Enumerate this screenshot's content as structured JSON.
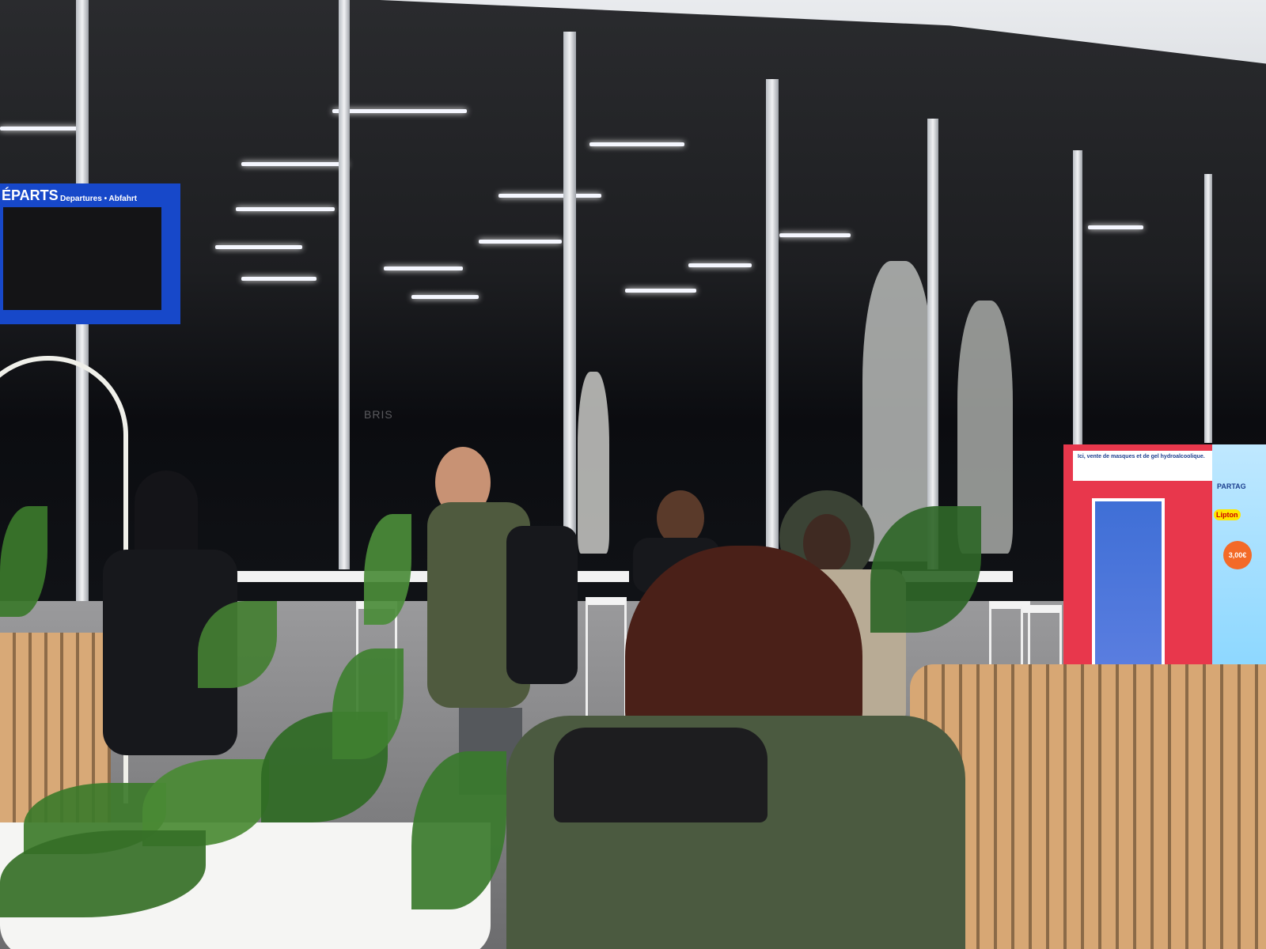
{
  "scene": {
    "description_type": "photo",
    "departures_sign": {
      "title": "ÉPARTS",
      "subtitle": "Departures • Abfahrt",
      "color": "#1748c9"
    },
    "background_sign_text": "BRIS",
    "vending_machine": {
      "banner_text": "Ici, vente de masques et de gel hydroalcoolique.",
      "color": "#e8374c"
    },
    "advert": {
      "brand": "Lipton",
      "headline_fragment": "PARTAG",
      "price": "3,00€"
    }
  }
}
